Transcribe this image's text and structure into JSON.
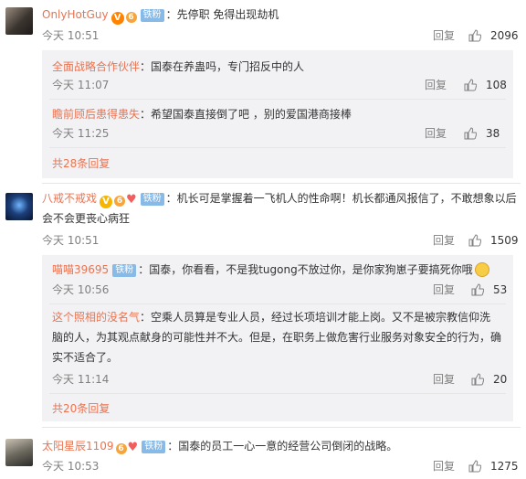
{
  "icons": {
    "verified": "V",
    "vip": "6",
    "heart": "♥",
    "like": "thumbs-up-icon",
    "laugh": "laugh-emoji"
  },
  "colors": {
    "name": "#eb7350",
    "fan_badge": "#87bae6",
    "sub_bg": "#f2f2f5"
  },
  "comments": [
    {
      "user": "OnlyHotGuy",
      "badge": "铁粉",
      "text": "：先停职 免得出现劫机",
      "time": "今天 10:51",
      "reply_label": "回复",
      "likes": "2096",
      "replies": [
        {
          "user": "全面战略合作伙伴",
          "text": "：国泰在养蛊吗，专门招反中的人",
          "time": "今天 11:07",
          "reply_label": "回复",
          "likes": "108"
        },
        {
          "user": "瞻前顾后患得患失",
          "text": "：希望国泰直接倒了吧 ，别的爱国港商接棒",
          "time": "今天 11:25",
          "reply_label": "回复",
          "likes": "38"
        }
      ],
      "more": "共28条回复"
    },
    {
      "user": "八戒不戒戏",
      "badge": "铁粉",
      "text_line1": "：机长可是掌握着一飞机人的性命啊！机长都通风报信了，不敢想象以后",
      "text_line2": "会不会更丧心病狂",
      "time": "今天 10:51",
      "reply_label": "回复",
      "likes": "1509",
      "replies": [
        {
          "user": "喵喵39695",
          "badge": "铁粉",
          "text": "：国泰，你看看，不是我tugong不放过你，是你家狗崽子要搞死你哦",
          "time": "今天 10:56",
          "reply_label": "回复",
          "likes": "53"
        },
        {
          "user": "这个照相的没名气",
          "text_line1": "：空乘人员算是专业人员，经过长项培训才能上岗。又不是被宗教信仰洗",
          "text_line2": "脑的人，为其观点献身的可能性并不大。但是，在职务上做危害行业服务对象安全的行为，确",
          "text_line3": "实不适合了。",
          "time": "今天 11:14",
          "reply_label": "回复",
          "likes": "20"
        }
      ],
      "more": "共20条回复"
    },
    {
      "user": "太阳星辰1109",
      "badge": "铁粉",
      "text": "：国泰的员工一心一意的经营公司倒闭的战略。",
      "time": "今天 10:53",
      "reply_label": "回复",
      "likes": "1275"
    }
  ]
}
